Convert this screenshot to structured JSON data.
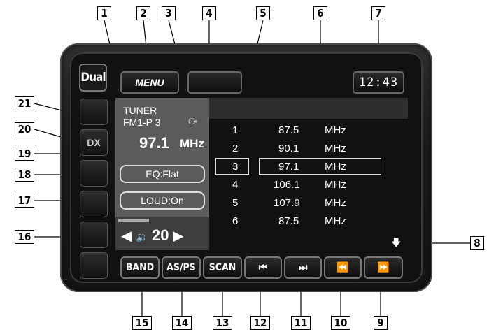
{
  "device": {
    "logo": "Dual",
    "menu_label": "MENU",
    "clock": "12:43",
    "side_label": "DX"
  },
  "tuner_panel": {
    "source": "TUNER",
    "band_preset": "FM1-P 3",
    "stereo_icon": "stereo-icon",
    "frequency": "97.1",
    "frequency_unit": "MHz",
    "eq_label": "EQ:Flat",
    "loudness_label": "LOUD:On",
    "volume": "20",
    "volume_icon": "speaker-icon"
  },
  "presets": [
    {
      "num": "1",
      "freq": "87.5",
      "unit": "MHz"
    },
    {
      "num": "2",
      "freq": "90.1",
      "unit": "MHz"
    },
    {
      "num": "3",
      "freq": "97.1",
      "unit": "MHz"
    },
    {
      "num": "4",
      "freq": "106.1",
      "unit": "MHz"
    },
    {
      "num": "5",
      "freq": "107.9",
      "unit": "MHz"
    },
    {
      "num": "6",
      "freq": "87.5",
      "unit": "MHz"
    }
  ],
  "selected_preset": "3",
  "bottom_buttons": [
    {
      "label": "BAND",
      "icon": ""
    },
    {
      "label": "AS/PS",
      "icon": ""
    },
    {
      "label": "SCAN",
      "icon": ""
    },
    {
      "label": "",
      "icon": "previous-track-icon"
    },
    {
      "label": "",
      "icon": "next-track-icon"
    },
    {
      "label": "",
      "icon": "rewind-icon"
    },
    {
      "label": "",
      "icon": "fast-forward-icon"
    }
  ],
  "callouts": [
    "1",
    "2",
    "3",
    "4",
    "5",
    "6",
    "7",
    "8",
    "9",
    "10",
    "11",
    "12",
    "13",
    "14",
    "15",
    "16",
    "17",
    "18",
    "19",
    "20",
    "21"
  ]
}
